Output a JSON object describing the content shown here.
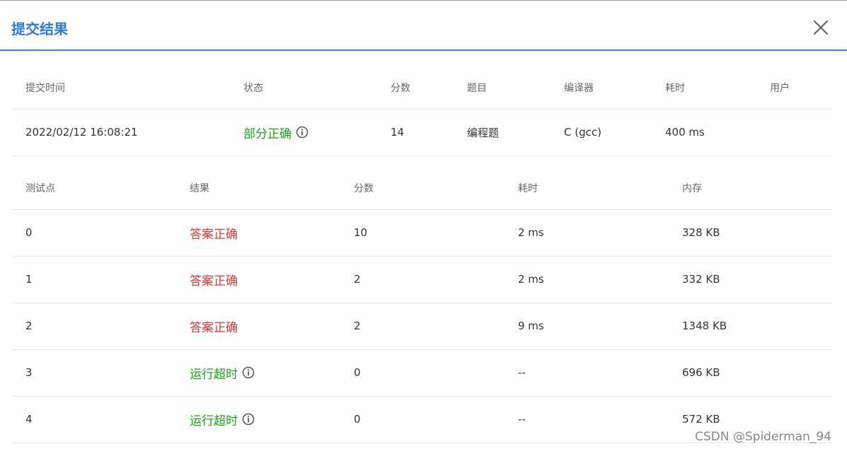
{
  "dialog": {
    "title": "提交结果"
  },
  "icons": {
    "close": "close-icon",
    "info": "info-circle-icon"
  },
  "colors": {
    "accent": "#2e7bd6",
    "success": "#1aa31a",
    "error": "#e53935"
  },
  "summary": {
    "headers": [
      "提交时间",
      "状态",
      "分数",
      "题目",
      "编译器",
      "耗时",
      "用户"
    ],
    "row": {
      "time": "2022/02/12 16:08:21",
      "status": "部分正确",
      "score": "14",
      "problem": "编程题",
      "compiler": "C (gcc)",
      "duration": "400 ms",
      "user": ""
    }
  },
  "cases": {
    "headers": [
      "测试点",
      "结果",
      "分数",
      "耗时",
      "内存"
    ],
    "rows": [
      {
        "id": "0",
        "result": "答案正确",
        "score": "10",
        "time": "2 ms",
        "memory": "328 KB"
      },
      {
        "id": "1",
        "result": "答案正确",
        "score": "2",
        "time": "2 ms",
        "memory": "332 KB"
      },
      {
        "id": "2",
        "result": "答案正确",
        "score": "2",
        "time": "9 ms",
        "memory": "1348 KB"
      },
      {
        "id": "3",
        "result": "运行超时",
        "score": "0",
        "time": "--",
        "memory": "696 KB"
      },
      {
        "id": "4",
        "result": "运行超时",
        "score": "0",
        "time": "--",
        "memory": "572 KB"
      }
    ]
  },
  "watermark": "CSDN @Spiderman_94"
}
